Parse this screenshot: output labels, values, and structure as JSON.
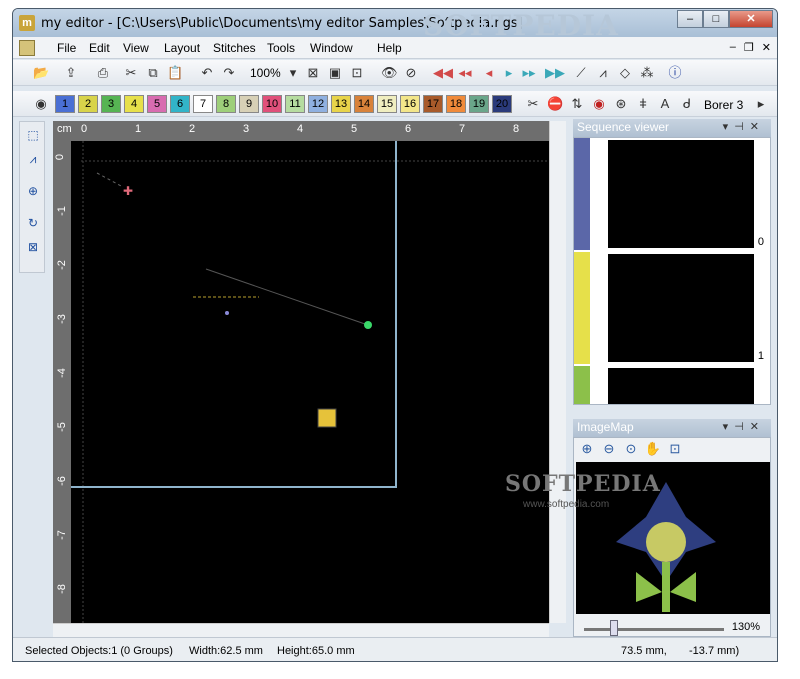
{
  "window": {
    "title": "my editor - [C:\\Users\\Public\\Documents\\my editor Samples\\Softpedia.ngs]",
    "watermark_top": "SOFTPEDIA"
  },
  "menu": [
    "File",
    "Edit",
    "View",
    "Layout",
    "Stitches",
    "Tools",
    "Window",
    "Help"
  ],
  "toolbar": {
    "zoom": "100%"
  },
  "colors": [
    {
      "num": "1",
      "hex": "#4a6fd4"
    },
    {
      "num": "2",
      "hex": "#d8d34a"
    },
    {
      "num": "3",
      "hex": "#56b453"
    },
    {
      "num": "4",
      "hex": "#e7e04a"
    },
    {
      "num": "5",
      "hex": "#d86cb0"
    },
    {
      "num": "6",
      "hex": "#32b4c8"
    },
    {
      "num": "7",
      "hex": "#ffffff"
    },
    {
      "num": "8",
      "hex": "#9ecf7a"
    },
    {
      "num": "9",
      "hex": "#d7d0b6"
    },
    {
      "num": "10",
      "hex": "#e0507a"
    },
    {
      "num": "11",
      "hex": "#b6dca0"
    },
    {
      "num": "12",
      "hex": "#8fb0e0"
    },
    {
      "num": "13",
      "hex": "#e8d44a"
    },
    {
      "num": "14",
      "hex": "#d8823a"
    },
    {
      "num": "15",
      "hex": "#f0eec0"
    },
    {
      "num": "16",
      "hex": "#f3e68a"
    },
    {
      "num": "17",
      "hex": "#a85a2a"
    },
    {
      "num": "18",
      "hex": "#f08a3a"
    },
    {
      "num": "19",
      "hex": "#6aa68a"
    },
    {
      "num": "20",
      "hex": "#2a3a7a"
    }
  ],
  "borer": "Borer 3",
  "ruler": {
    "unit": "cm",
    "top": [
      "0",
      "1",
      "2",
      "3",
      "4",
      "5",
      "6",
      "7",
      "8"
    ],
    "left": [
      "0",
      "-1",
      "-2",
      "-3",
      "-4",
      "-5",
      "-6",
      "-7",
      "-8"
    ]
  },
  "sequence_viewer": {
    "title": "Sequence viewer",
    "items": [
      {
        "num": "0",
        "bar": "#5b67a8"
      },
      {
        "num": "1",
        "bar": "#e6e04a"
      },
      {
        "num": "",
        "bar": "#8cc04a"
      }
    ]
  },
  "imagemap": {
    "title": "ImageMap",
    "zoom": "130%",
    "wm": "SOFTPEDIA",
    "wm_url": "www.softpedia.com"
  },
  "status": {
    "selected": "Selected Objects:1 (0 Groups)",
    "width": "Width:62.5 mm",
    "height": "Height:65.0 mm",
    "coords": "73.5 mm,",
    "coords2": "-13.7 mm)"
  }
}
